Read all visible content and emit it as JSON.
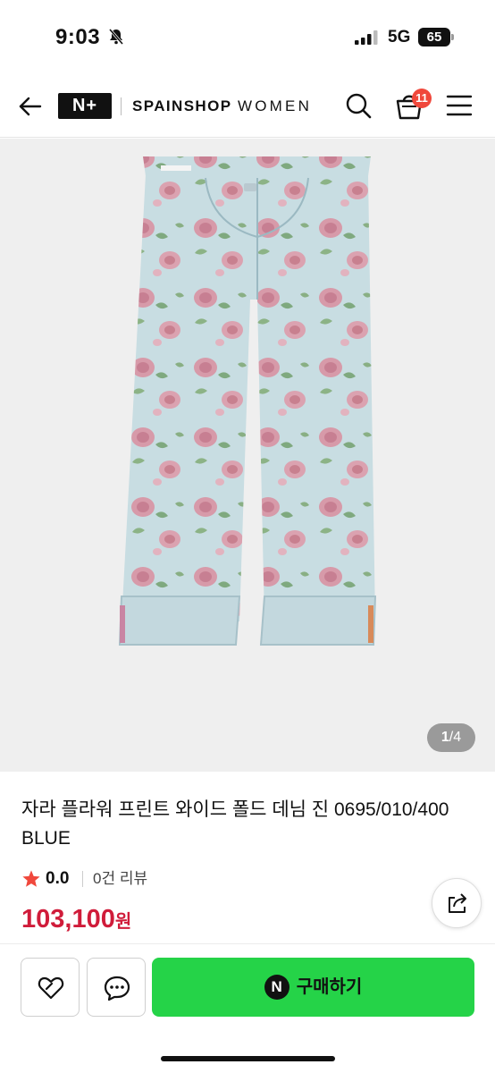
{
  "status_bar": {
    "time": "9:03",
    "network": "5G",
    "battery": "65"
  },
  "header": {
    "logo": "N+",
    "shop_name": "SPAINSHOP",
    "shop_subtitle": "WOMEN",
    "cart_count": "11"
  },
  "gallery": {
    "current": "1",
    "total": "/4"
  },
  "product": {
    "title": "자라 플라워 프린트 와이드 폴드 데님 진 0695/010/400 BLUE",
    "rating": "0.0",
    "reviews": "0건 리뷰",
    "price": "103,100",
    "currency": "원"
  },
  "actions": {
    "npay_mark": "N",
    "buy_label": "구매하기"
  },
  "colors": {
    "price": "#d01c3a",
    "buy_button": "#25d348",
    "badge": "#f0483c",
    "star": "#f0483c"
  },
  "icons": [
    "arrow-left-icon",
    "search-icon",
    "shopping-bag-icon",
    "hamburger-menu-icon",
    "star-icon",
    "share-icon",
    "heart-icon",
    "chat-bubble-icon",
    "bell-off-icon",
    "signal-icon",
    "battery-icon"
  ]
}
